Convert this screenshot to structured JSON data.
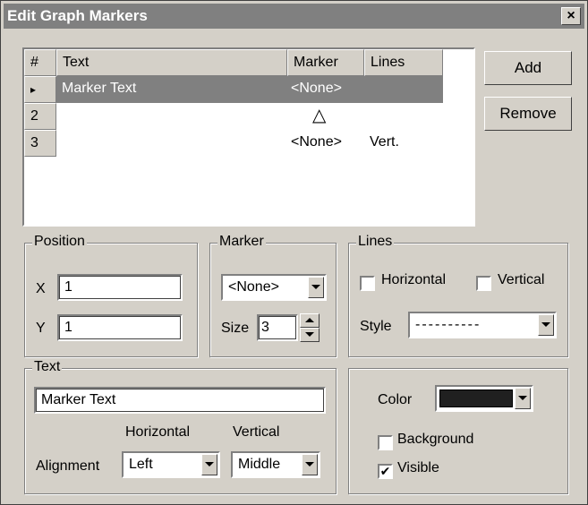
{
  "window": {
    "title": "Edit Graph Markers",
    "close_glyph": "×"
  },
  "grid": {
    "headers": [
      "#",
      "Text",
      "Marker",
      "Lines"
    ],
    "rows": [
      {
        "num": "▸",
        "text": "Marker Text",
        "marker": "<None>",
        "lines": ""
      },
      {
        "num": "2",
        "text": "",
        "marker": "△",
        "lines": ""
      },
      {
        "num": "3",
        "text": "",
        "marker": "<None>",
        "lines": "Vert."
      }
    ]
  },
  "buttons": {
    "add": "Add",
    "remove": "Remove"
  },
  "position": {
    "legend": "Position",
    "x_label": "X",
    "x_value": "1",
    "y_label": "Y",
    "y_value": "1"
  },
  "marker": {
    "legend": "Marker",
    "type_value": "<None>",
    "size_label": "Size",
    "size_value": "3"
  },
  "lines": {
    "legend": "Lines",
    "horizontal_label": "Horizontal",
    "horizontal_checked": false,
    "vertical_label": "Vertical",
    "vertical_checked": false,
    "style_label": "Style",
    "style_value": "----------"
  },
  "text": {
    "legend": "Text",
    "value": "Marker Text",
    "alignment_label": "Alignment",
    "horizontal_label": "Horizontal",
    "vertical_label": "Vertical",
    "horizontal_value": "Left",
    "vertical_value": "Middle"
  },
  "appearance": {
    "color_label": "Color",
    "color_value": "#202020",
    "background_label": "Background",
    "background_checked": false,
    "visible_label": "Visible",
    "visible_checked": true,
    "check_glyph": "✔"
  },
  "colors": {
    "window_bg": "#d4d0c8",
    "titlebar_bg": "#808080",
    "selection_bg": "#808080"
  }
}
